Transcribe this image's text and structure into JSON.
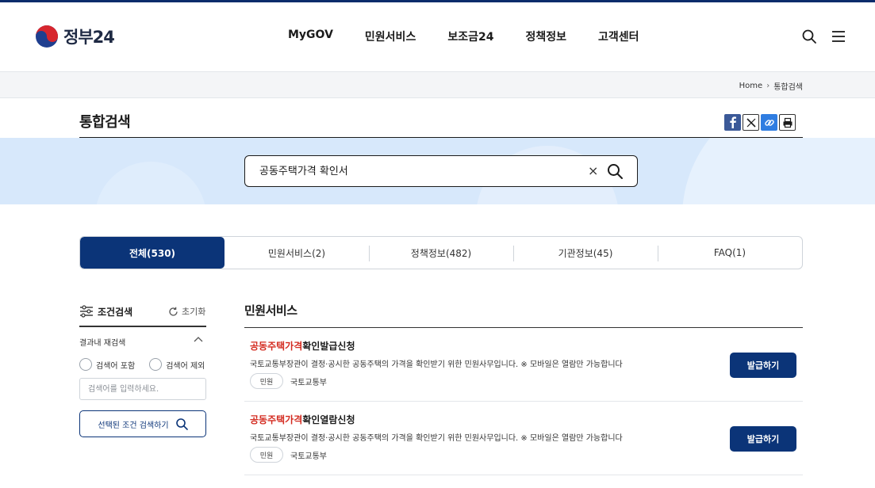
{
  "header": {
    "logo_text": "정부24",
    "nav": [
      "MyGOV",
      "민원서비스",
      "보조금24",
      "정책정보",
      "고객센터"
    ],
    "icons": [
      "search-icon",
      "hamburger-menu-icon"
    ]
  },
  "breadcrumb": {
    "home": "Home",
    "current": "통합검색"
  },
  "page": {
    "title": "통합검색",
    "share_icons": [
      "facebook-icon",
      "x-icon",
      "link-icon",
      "print-icon"
    ]
  },
  "search": {
    "query": "공동주택가격 확인서",
    "clear": "×"
  },
  "tabs": [
    {
      "label": "전체(530)",
      "active": true
    },
    {
      "label": "민원서비스(2)",
      "active": false
    },
    {
      "label": "정책정보(482)",
      "active": false
    },
    {
      "label": "기관정보(45)",
      "active": false
    },
    {
      "label": "FAQ(1)",
      "active": false
    }
  ],
  "filter": {
    "title": "조건검색",
    "reset": "초기화",
    "refine_label": "결과내 재검색",
    "include": "검색어 포함",
    "exclude": "검색어 제외",
    "input_placeholder": "검색어를 입력하세요.",
    "apply": "선택된 조건 검색하기"
  },
  "results": {
    "section_title": "민원서비스",
    "items": [
      {
        "highlight": "공동주택가격",
        "title_rest": "확인발급신청",
        "desc": "국토교통부장관이 결정·공시한 공동주택의 가격을 확인받기 위한 민원사무입니다. ※ 모바일은 열람만 가능합니다",
        "badge": "민원",
        "org": "국토교통부",
        "button": "발급하기"
      },
      {
        "highlight": "공동주택가격",
        "title_rest": "확인열람신청",
        "desc": "국토교통부장관이 결정·공시한 공동주택의 가격을 확인받기 위한 민원사무입니다. ※ 모바일은 열람만 가능합니다",
        "badge": "민원",
        "org": "국토교통부",
        "button": "발급하기"
      }
    ]
  },
  "colors": {
    "brand_navy": "#0b3478",
    "highlight_red": "#d32a1f",
    "search_band": "#d7e8fb"
  }
}
